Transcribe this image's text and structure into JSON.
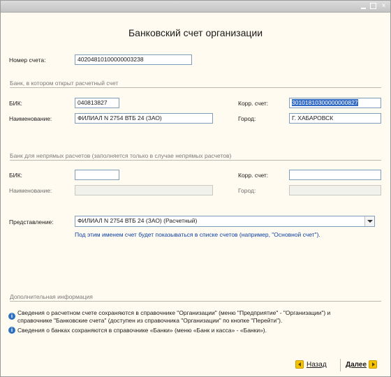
{
  "window": {
    "title": "Банковский счет организации",
    "controls": {
      "minimize": "_",
      "maximize": "□",
      "close": "×"
    }
  },
  "account": {
    "number_label": "Номер счета:",
    "number_value": "40204810100000003238"
  },
  "bank": {
    "section_title": "Банк, в котором открыт расчетный счет",
    "bik_label": "БИК:",
    "bik_value": "040813827",
    "korr_label": "Корр. счет:",
    "korr_value": "30101810300000000827",
    "name_label": "Наименование:",
    "name_value": "ФИЛИАЛ N 2754 ВТБ 24 (ЗАО)",
    "city_label": "Город:",
    "city_value": "Г. ХАБАРОВСК"
  },
  "indirect_bank": {
    "section_title": "Банк для непрямых расчетов (заполняется только в случае непрямых расчетов)",
    "bik_label": "БИК:",
    "bik_value": "",
    "korr_label": "Корр. счет:",
    "korr_value": "",
    "name_label": "Наименование:",
    "name_value": "",
    "city_label": "Город:",
    "city_value": ""
  },
  "presentation": {
    "label": "Представление:",
    "value": "ФИЛИАЛ N 2754 ВТБ 24 (ЗАО) (Расчетный)",
    "hint": "Под этим именем счет будет показываться в списке счетов (например, \"Основной счет\")."
  },
  "additional": {
    "section_title": "Дополнительная информация",
    "info1": "Сведения о расчетном счете сохраняются в справочнике \"Организации\" (меню \"Предприятие\" - \"Организации\") и справочнике \"Банковские счета\" (доступен из справочника \"Организации\" по кнопке \"Перейти\").",
    "info2": "Сведения о банках сохраняются в справочнике «Банки» (меню «Банк и касса» - «Банки»)."
  },
  "navigation": {
    "back_label": "Назад",
    "next_label": "Далее"
  },
  "colors": {
    "background": "#fffbf0",
    "selection": "#316ac5",
    "hint_text": "#0a3ea8",
    "nav_button": "#f5c400"
  }
}
